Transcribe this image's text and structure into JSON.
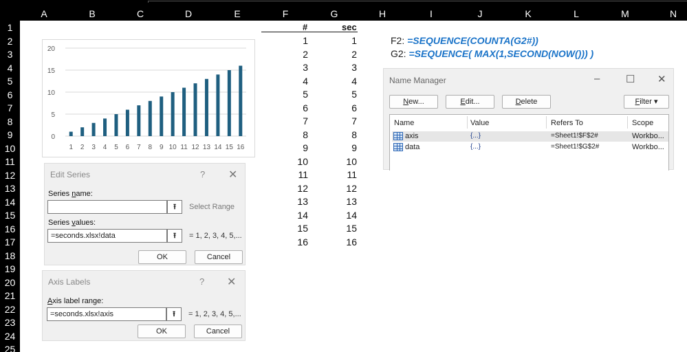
{
  "columns": [
    "A",
    "B",
    "C",
    "D",
    "E",
    "F",
    "G",
    "H",
    "I",
    "J",
    "K",
    "L",
    "M",
    "N"
  ],
  "rows": [
    "1",
    "2",
    "3",
    "4",
    "5",
    "6",
    "7",
    "8",
    "9",
    "10",
    "11",
    "12",
    "13",
    "14",
    "15",
    "16",
    "17",
    "18",
    "19",
    "20",
    "21",
    "22",
    "23",
    "24",
    "25"
  ],
  "sheet": {
    "f_header": "#",
    "g_header": "sec",
    "f_values": [
      "1",
      "2",
      "3",
      "4",
      "5",
      "6",
      "7",
      "8",
      "9",
      "10",
      "11",
      "12",
      "13",
      "14",
      "15",
      "16"
    ],
    "g_values": [
      "1",
      "2",
      "3",
      "4",
      "5",
      "6",
      "7",
      "8",
      "9",
      "10",
      "11",
      "12",
      "13",
      "14",
      "15",
      "16"
    ],
    "formula1_cell": "F2:",
    "formula1_text": "=SEQUENCE(COUNTA(G2#))",
    "formula2_cell": "G2:",
    "formula2_text": "=SEQUENCE( MAX(1,SECOND(NOW())) )"
  },
  "chart_data": {
    "type": "bar",
    "categories": [
      "1",
      "2",
      "3",
      "4",
      "5",
      "6",
      "7",
      "8",
      "9",
      "10",
      "11",
      "12",
      "13",
      "14",
      "15",
      "16"
    ],
    "values": [
      1,
      2,
      3,
      4,
      5,
      6,
      7,
      8,
      9,
      10,
      11,
      12,
      13,
      14,
      15,
      16
    ],
    "ylim": [
      0,
      20
    ],
    "yticks": [
      "0",
      "5",
      "10",
      "15",
      "20"
    ],
    "grid": true,
    "bar_color": "#1f5f80"
  },
  "edit_series": {
    "title": "Edit Series",
    "help": "?",
    "close": "✕",
    "name_label_pre": "Series ",
    "name_label_u": "n",
    "name_label_post": "ame:",
    "name_value": "",
    "select_range": "Select Range",
    "values_label_pre": "Series ",
    "values_label_u": "v",
    "values_label_post": "alues:",
    "values_value": "=seconds.xlsx!data",
    "values_preview": "= 1, 2, 3, 4, 5,...",
    "ok": "OK",
    "cancel": "Cancel"
  },
  "axis_labels": {
    "title": "Axis Labels",
    "help": "?",
    "close": "✕",
    "range_label_u": "A",
    "range_label_post": "xis label range:",
    "range_value": "=seconds.xlsx!axis",
    "range_preview": "= 1, 2, 3, 4, 5,...",
    "ok": "OK",
    "cancel": "Cancel"
  },
  "name_manager": {
    "title": "Name Manager",
    "minimize": "–",
    "maximize": "☐",
    "close": "✕",
    "new_u": "N",
    "new_post": "ew...",
    "edit_u": "E",
    "edit_post": "dit...",
    "delete_u": "D",
    "delete_post": "elete",
    "filter_u": "F",
    "filter_post": "ilter ▾",
    "headers": [
      "Name",
      "Value",
      "Refers To",
      "Scope"
    ],
    "names": [
      {
        "name": "axis",
        "value": "{...}",
        "refers_to": "=Sheet1!$F$2#",
        "scope": "Workbo..."
      },
      {
        "name": "data",
        "value": "{...}",
        "refers_to": "=Sheet1!$G$2#",
        "scope": "Workbo..."
      }
    ]
  }
}
